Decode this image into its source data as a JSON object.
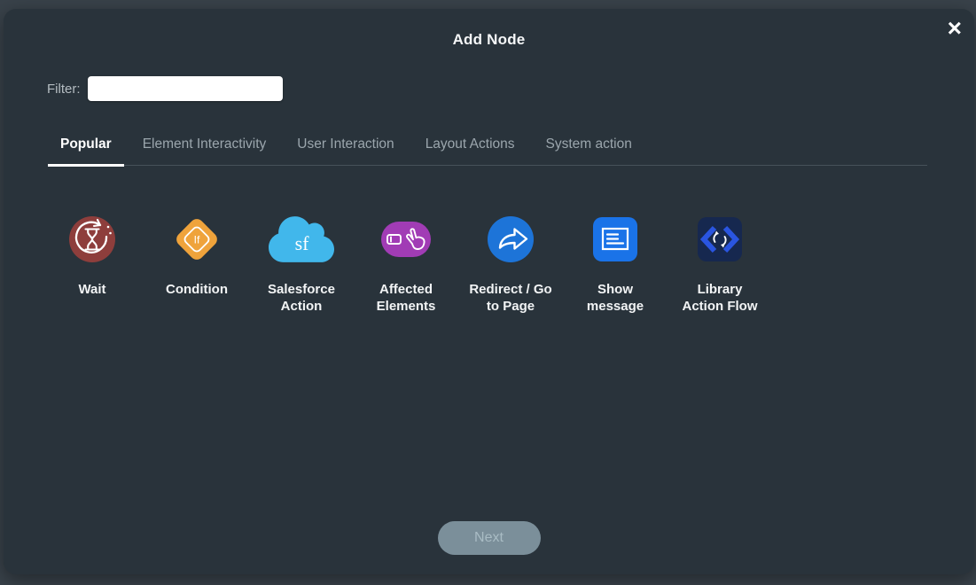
{
  "modal": {
    "title": "Add Node"
  },
  "icons": {
    "close_glyph": "×"
  },
  "filter": {
    "label": "Filter:",
    "value": "",
    "placeholder": ""
  },
  "tabs": [
    {
      "label": "Popular",
      "active": true
    },
    {
      "label": "Element Interactivity",
      "active": false
    },
    {
      "label": "User Interaction",
      "active": false
    },
    {
      "label": "Layout Actions",
      "active": false
    },
    {
      "label": "System action",
      "active": false
    }
  ],
  "nodes": [
    {
      "label": "Wait",
      "color": "#8e3e3c",
      "icon": "wait-hourglass-icon"
    },
    {
      "label": "Condition",
      "badge": "If",
      "color": "#efa33b",
      "icon": "condition-if-icon"
    },
    {
      "label": "Salesforce Action",
      "badge": "sf",
      "color": "#41b7eb",
      "icon": "salesforce-cloud-icon"
    },
    {
      "label": "Affected Elements",
      "color": "#a13cb5",
      "icon": "affected-elements-icon"
    },
    {
      "label": "Redirect / Go to Page",
      "color": "#1d74d8",
      "icon": "redirect-arrow-icon"
    },
    {
      "label": "Show message",
      "color": "#1a73e8",
      "icon": "show-message-icon"
    },
    {
      "label": "Library Action Flow",
      "color": "#16284f",
      "accent": "#2a55e0",
      "icon": "library-action-flow-icon"
    }
  ],
  "footer": {
    "next_label": "Next",
    "next_enabled": false
  },
  "theme": {
    "page_bg": "#39424a",
    "modal_bg": "#29333b",
    "active_tab_underline": "#ffffff",
    "inactive_tab_text": "#9ba6ad",
    "disabled_button_bg": "#7b8f9a"
  }
}
